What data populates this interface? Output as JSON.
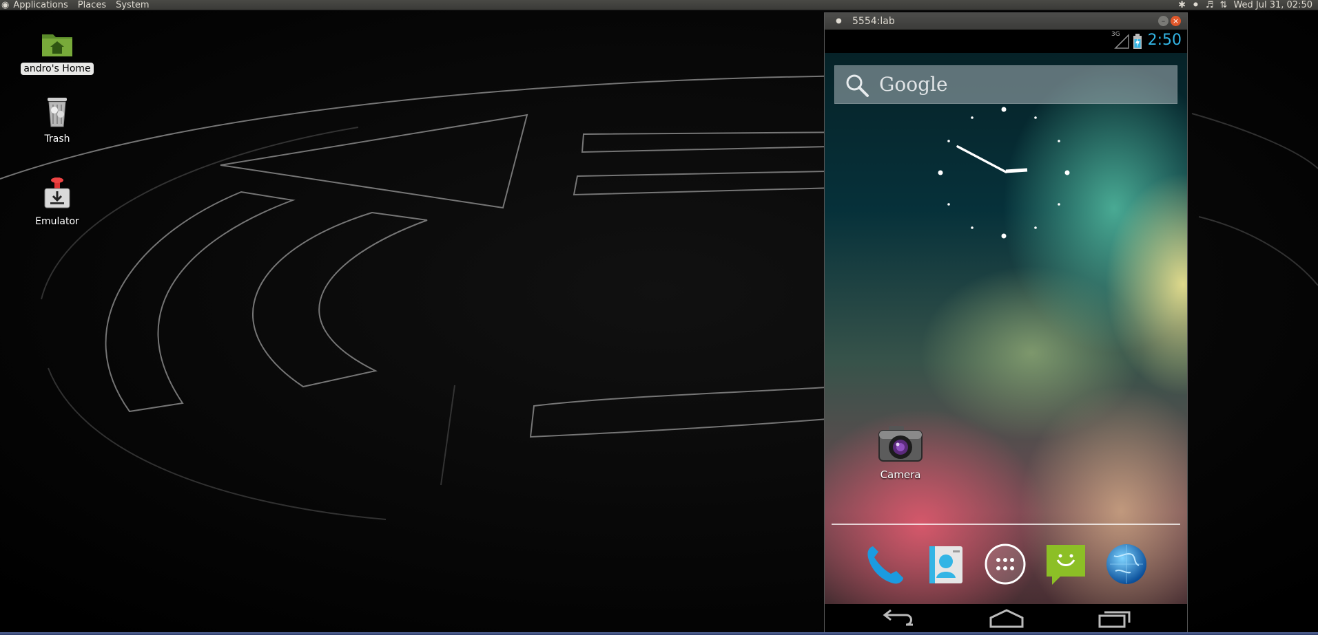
{
  "top_panel": {
    "menus": [
      "Applications",
      "Places",
      "System"
    ],
    "datetime": "Wed Jul 31, 02:50"
  },
  "desktop": {
    "icons": [
      {
        "label": "andro's Home",
        "icon": "home-folder-icon",
        "selected": true
      },
      {
        "label": "Trash",
        "icon": "trash-icon",
        "selected": false
      },
      {
        "label": "Emulator",
        "icon": "emulator-icon",
        "selected": false
      }
    ]
  },
  "emulator_window": {
    "title": "5554:lab",
    "android": {
      "status_bar": {
        "network": "3G",
        "time": "2:50"
      },
      "search": {
        "placeholder": "Google"
      },
      "analog_clock": {
        "hour": 2,
        "minute": 50
      },
      "apps": [
        {
          "label": "Camera",
          "icon": "camera-icon"
        }
      ],
      "dock": [
        "phone-icon",
        "contacts-icon",
        "app-drawer-icon",
        "messaging-icon",
        "browser-icon"
      ],
      "nav_buttons": [
        "back-icon",
        "home-icon",
        "recent-apps-icon"
      ]
    }
  },
  "colors": {
    "android_accent": "#33b5e5",
    "close_button": "#e0572a",
    "panel": "#3e3e3b"
  }
}
